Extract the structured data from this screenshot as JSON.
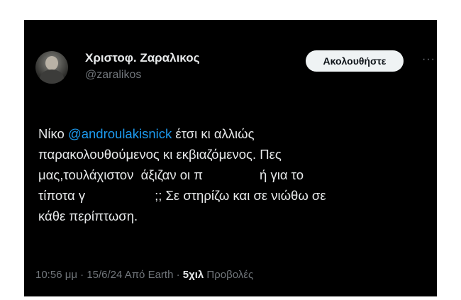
{
  "author": {
    "display_name": "Χριστοφ. Ζαραλικος",
    "handle": "@zaralikos"
  },
  "follow_button": {
    "label": "Ακολουθήστε"
  },
  "more_icon": {
    "icon": "more-horizontal-icon",
    "glyph": "···"
  },
  "tweet": {
    "line1_a": "Νίκο ",
    "line1_mention": "@androulakisnick",
    "line1_b": " έτσι κι αλλιώς",
    "line2": "παρακολουθούμενος κι εκβιαζόμενος. Πες",
    "line3_a": "μας,τουλάχιστον  άξιζαν οι π",
    "line3_b": "ή για το",
    "line4_a": "τίποτα γ",
    "line4_b": ";; Σε στηρίζω και σε νιώθω σε",
    "line5": "κάθε περίπτωση."
  },
  "meta": {
    "timestamp": "10:56 μμ · 15/6/24 Από Earth · ",
    "views_count": "5χιλ",
    "views_label": " Προβολές"
  },
  "colors": {
    "background": "#000000",
    "text": "#e7e9ea",
    "secondary": "#71767b",
    "mention": "#1d9bf0",
    "button_bg": "#eff3f4"
  }
}
